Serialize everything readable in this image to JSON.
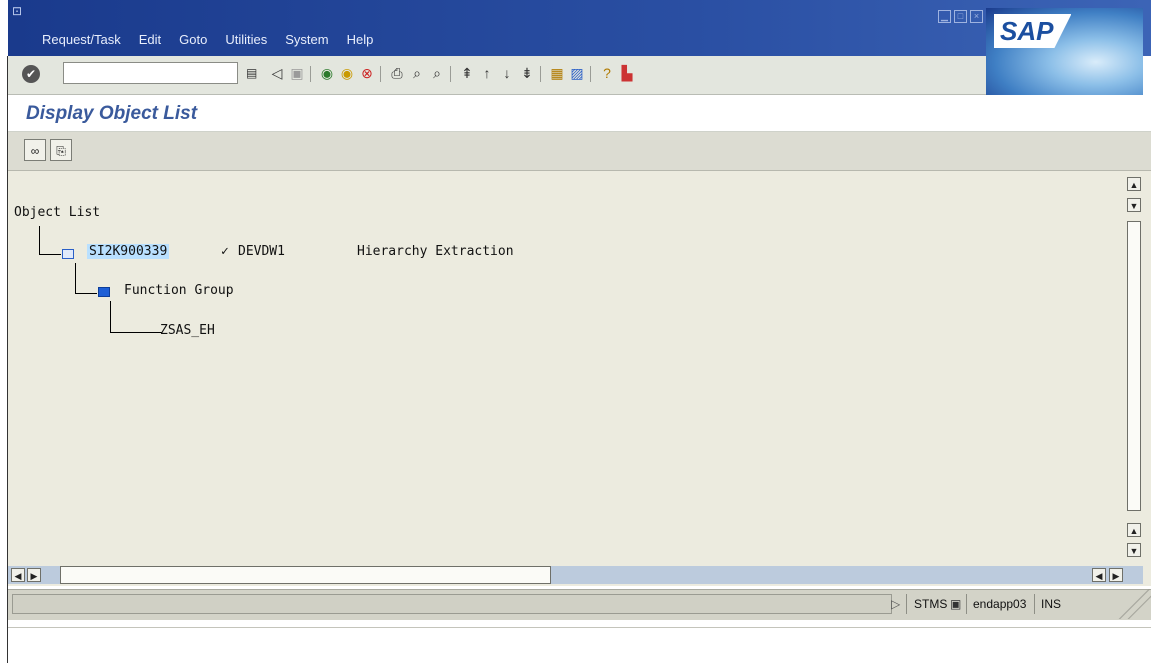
{
  "menubar": {
    "items": [
      "Request/Task",
      "Edit",
      "Goto",
      "Utilities",
      "System",
      "Help"
    ],
    "logo": "SAP"
  },
  "toolbar": {
    "command_value": "",
    "icons": [
      "enter-icon",
      "command-field-icon",
      "back-icon",
      "save-icon",
      "green-back-icon",
      "exit-icon",
      "cancel-icon",
      "print-icon",
      "find-icon",
      "find-next-icon",
      "first-page-icon",
      "previous-page-icon",
      "next-page-icon",
      "last-page-icon",
      "create-session-icon",
      "create-shortcut-icon",
      "help-icon",
      "layout-menu-icon"
    ]
  },
  "page": {
    "title": "Display Object List"
  },
  "app_toolbar": {
    "icons": [
      "display-icon",
      "document-icon"
    ]
  },
  "tree": {
    "root": "Object List",
    "request": {
      "number": "SI2K900339",
      "check": "✓",
      "target": "DEVDW1",
      "description": "Hierarchy Extraction"
    },
    "group": "Function Group",
    "object": "ZSAS_EH"
  },
  "status": {
    "transaction": "STMS",
    "server": "endapp03",
    "mode": "INS"
  },
  "colors": {
    "title_bar": "#1f3f8f",
    "page_title": "#3a5a9c",
    "selection": "#b9e0ff",
    "work_area": "#ecebdf"
  }
}
